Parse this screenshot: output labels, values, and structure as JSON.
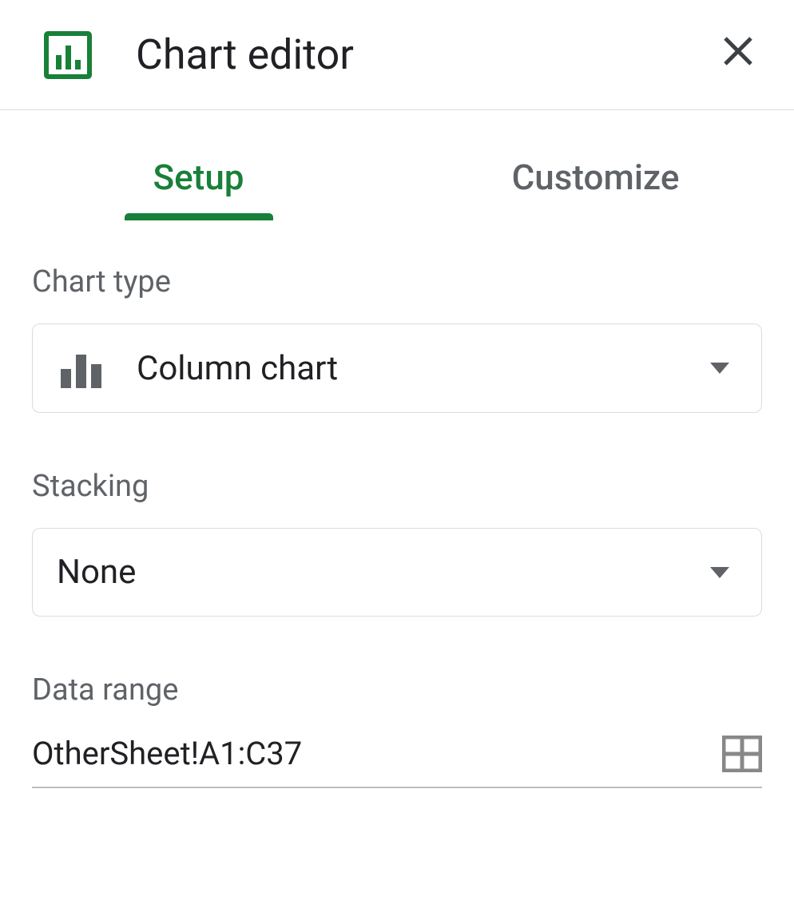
{
  "header": {
    "title": "Chart editor"
  },
  "tabs": {
    "setup": "Setup",
    "customize": "Customize"
  },
  "setup": {
    "chart_type_label": "Chart type",
    "chart_type_value": "Column chart",
    "stacking_label": "Stacking",
    "stacking_value": "None",
    "data_range_label": "Data range",
    "data_range_value": "OtherSheet!A1:C37"
  }
}
